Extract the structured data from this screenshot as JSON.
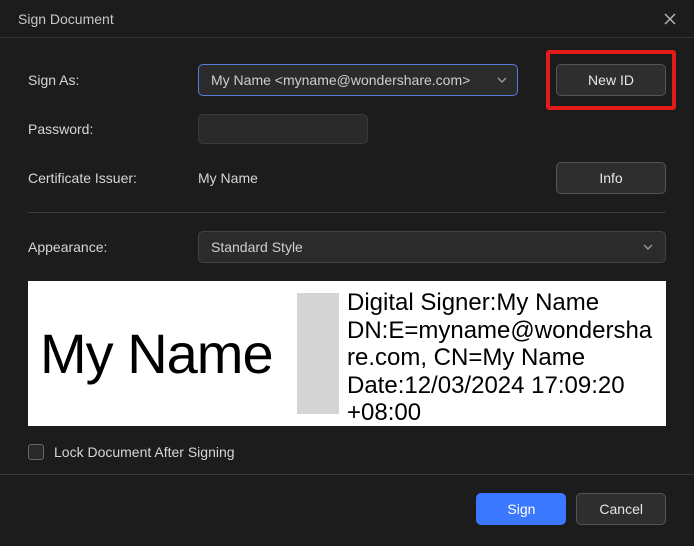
{
  "title": "Sign Document",
  "labels": {
    "sign_as": "Sign As:",
    "password": "Password:",
    "cert_issuer": "Certificate Issuer:",
    "appearance": "Appearance:",
    "lock": "Lock Document After Signing"
  },
  "sign_as": {
    "selected": "My Name <myname@wondershare.com>"
  },
  "buttons": {
    "new_id": "New ID",
    "info": "Info",
    "sign": "Sign",
    "cancel": "Cancel"
  },
  "cert_issuer_value": "My Name",
  "appearance_value": "Standard Style",
  "preview": {
    "name": "My Name",
    "line1": "Digital Signer:My Name",
    "line2": "DN:E=myname@wondershare.com, CN=My Name",
    "line3": "Date:12/03/2024 17:09:20 +08:00"
  }
}
